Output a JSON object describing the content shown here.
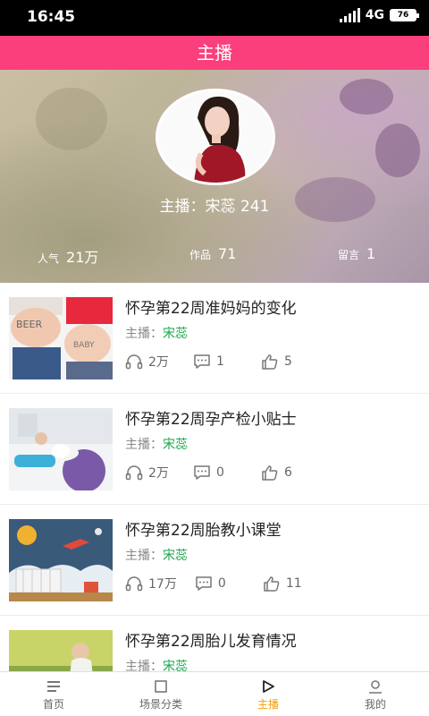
{
  "status_bar": {
    "time": "16:45",
    "network": "4G",
    "battery": "76"
  },
  "title_bar": {
    "title": "主播"
  },
  "anchor": {
    "name_line": "主播：宋蕊 241",
    "stats": [
      {
        "label": "人气",
        "value": "21万"
      },
      {
        "label": "作品",
        "value": "71"
      },
      {
        "label": "留言",
        "value": "1"
      }
    ]
  },
  "items": [
    {
      "title": "怀孕第22周准妈妈的变化",
      "host_label": "主播：",
      "host_name": "宋蕊",
      "plays": "2万",
      "comments": "1",
      "likes": "5",
      "thumb": "belly"
    },
    {
      "title": "怀孕第22周孕产检小贴士",
      "host_label": "主播：",
      "host_name": "宋蕊",
      "plays": "2万",
      "comments": "0",
      "likes": "6",
      "thumb": "yoga"
    },
    {
      "title": "怀孕第22周胎教小课堂",
      "host_label": "主播：",
      "host_name": "宋蕊",
      "plays": "17万",
      "comments": "0",
      "likes": "11",
      "thumb": "nursery"
    },
    {
      "title": "怀孕第22周胎儿发育情况",
      "host_label": "主播：",
      "host_name": "宋蕊",
      "plays": "",
      "comments": "",
      "likes": "",
      "thumb": "nature"
    }
  ],
  "tab_bar": {
    "tabs": [
      {
        "label": "首页",
        "icon": "menu-icon",
        "active": false
      },
      {
        "label": "场景分类",
        "icon": "square-icon",
        "active": false
      },
      {
        "label": "主播",
        "icon": "play-icon",
        "active": true
      },
      {
        "label": "我的",
        "icon": "person-icon",
        "active": false
      }
    ]
  },
  "colors": {
    "accent": "#fb3f7c",
    "tab_active": "#f0a010",
    "host_name": "#1aa64a"
  }
}
